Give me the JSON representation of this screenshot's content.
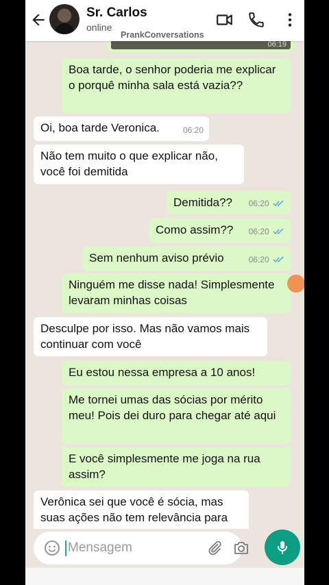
{
  "header": {
    "contact_name": "Sr. Carlos",
    "status": "online",
    "watermark": "PrankConversations"
  },
  "top_image": {
    "time": "06:19"
  },
  "messages": [
    {
      "side": "out",
      "text": "Boa tarde, o senhor poderia me explicar o porquê minha sala está vazia??",
      "time": ""
    },
    {
      "side": "in",
      "text": "Oi, boa tarde Veronica.",
      "time": "06:20"
    },
    {
      "side": "in",
      "text": "Não tem muito o que explicar não, você foi demitida",
      "time": ""
    },
    {
      "side": "out",
      "text": "Demitida??",
      "time": "06:20"
    },
    {
      "side": "out",
      "text": "Como assim??",
      "time": "06:20"
    },
    {
      "side": "out",
      "text": "Sem nenhum aviso prévio",
      "time": "06:20"
    },
    {
      "side": "out",
      "text": "Ninguém me disse nada! Simplesmente levaram minhas coisas",
      "time": ""
    },
    {
      "side": "in",
      "text": "Desculpe por isso. Mas não vamos mais continuar com você",
      "time": ""
    },
    {
      "side": "out",
      "text": "Eu estou nessa empresa a 10 anos!",
      "time": ""
    },
    {
      "side": "out",
      "text": "Me tornei umas das sócias por mérito meu! Pois dei duro para chegar até aqui",
      "time": ""
    },
    {
      "side": "out",
      "text": "E você simplesmente me joga na rua assim?",
      "time": ""
    },
    {
      "side": "in",
      "text": "Verônica sei que você é sócia, mas suas ações não tem relevância para",
      "time": ""
    }
  ],
  "input": {
    "placeholder": "Mensagem"
  },
  "colors": {
    "outgoing_bubble": "#dcf8c6",
    "incoming_bubble": "#ffffff",
    "chat_background": "#ece5dd",
    "accent": "#0b9e82",
    "read_ticks": "#4fa9e6"
  },
  "icons": [
    "back-arrow-icon",
    "video-call-icon",
    "phone-call-icon",
    "menu-dots-icon",
    "emoji-icon",
    "attach-icon",
    "camera-icon",
    "mic-icon",
    "double-check-icon"
  ]
}
